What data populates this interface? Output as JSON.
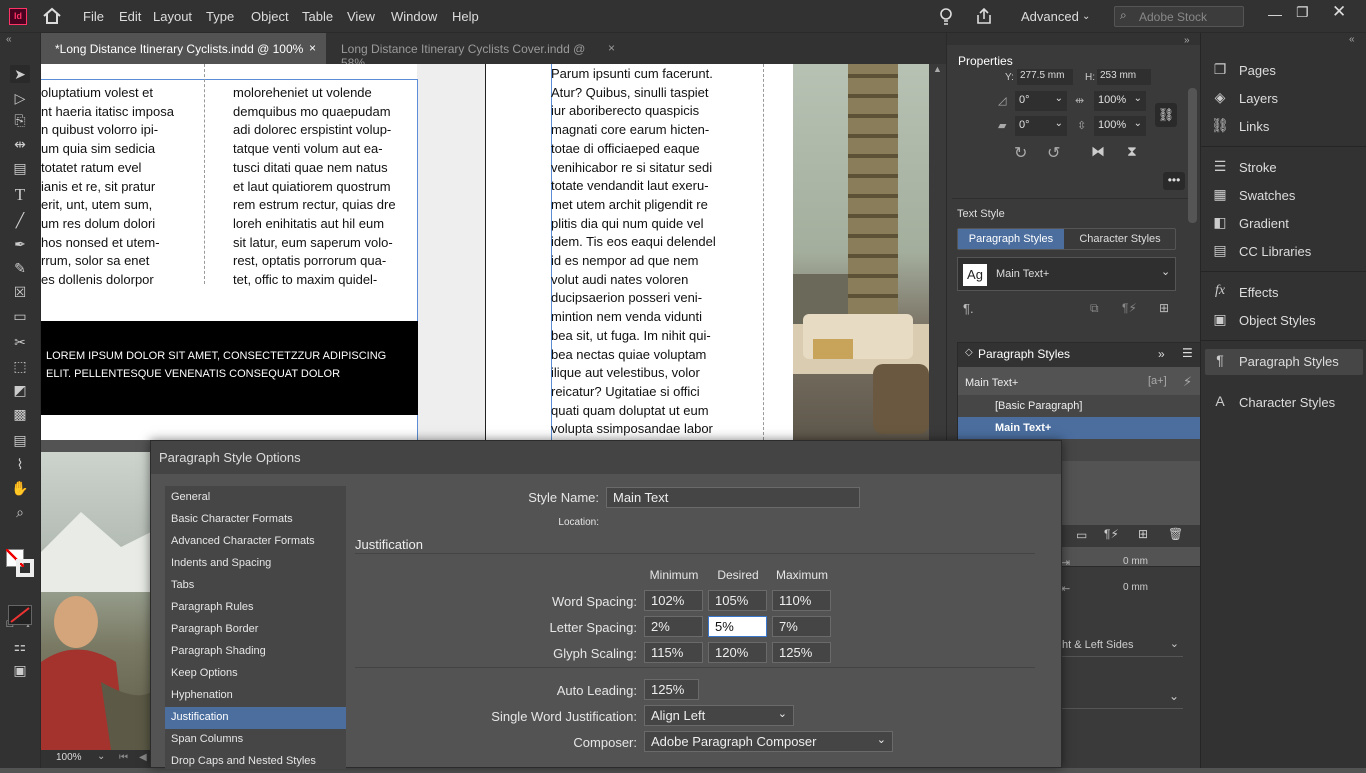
{
  "menubar": {
    "logo": "Id",
    "items": [
      "File",
      "Edit",
      "Layout",
      "Type",
      "Object",
      "Table",
      "View",
      "Window",
      "Help"
    ],
    "workspace": "Advanced",
    "search_placeholder": "Adobe Stock"
  },
  "tabs": [
    {
      "label": "*Long Distance Itinerary Cyclists.indd @ 100%",
      "close": "×"
    },
    {
      "label": "Long Distance Itinerary Cyclists Cover.indd @ 58%",
      "close": "×"
    }
  ],
  "document": {
    "col1": "oluptatium volest et\nnt haeria itatisc imposa\nn quibust volorro ipi-\num quia sim sedicia\ntotatet ratum evel\nianis et re, sit pratur\nerit, unt, utem sum,\num res dolum dolori\nhos nonsed et utem-\nrrum, solor sa enet\nes dollenis dolorpor",
    "col2": "moloreheniet ut volende\ndemquibus mo quaepudam\nadi dolorec erspistint volup-\ntatque venti volum aut ea-\ntusci ditati quae nem natus\net laut quiatiorem quostrum\nrem estrum rectur, quias dre\nloreh enihitatis aut hil eum\nsit latur, eum saperum volo-\nrest, optatis porrorum qua-\ntet, offic to maxim quidel-",
    "col3": "Parum ipsunti cum facerunt.\nAtur? Quibus, sinulli taspiet\niur aboriberecto quaspicis\nmagnati core earum hicten-\ntotae di officiaeped eaque\nvenihicabor re si sitatur sedi\ntotate vendandit laut exeru-\nmet utem archit pligendit re\nplitis dia qui num quide vel\nidem. Tis eos eaqui delendel\nid es nempor ad que nem\nvolut audi nates voloren\nducipsaerion posseri veni-\nmintion nem venda vidunti\nbea sit, ut fuga. Im nihit qui-\nbea nectas quiae voluptam\nilique aut velestibus, volor\nreicatur? Ugitatiae si offici\nquati quam doluptat ut eum\nvolupta ssimposandae labor",
    "banner": "LOREM IPSUM DOLOR SIT AMET, CONSECTETZZUR ADIPISCING\nELIT. PELLENTESQUE VENENATIS CONSEQUAT DOLOR"
  },
  "status": {
    "zoom": "100%"
  },
  "properties": {
    "title": "Properties",
    "y_label": "Y:",
    "y_value": "277.5 mm",
    "h_label": "H:",
    "h_value": "253 mm",
    "rotate": "0°",
    "shear": "0°",
    "scale_x": "100%",
    "scale_y": "100%",
    "text_style_title": "Text Style",
    "tab_paragraph": "Paragraph Styles",
    "tab_character": "Character Styles",
    "style_badge": "Ag",
    "current_style": "Main Text+",
    "para_panel_title": "Paragraph Styles",
    "para_panel_style": "Main Text+",
    "para_list": [
      "[Basic Paragraph]",
      "Main Text+"
    ],
    "indent_1": "0 mm",
    "indent_2": "0 mm",
    "align_partial": "ht & Left Sides"
  },
  "dock": {
    "items": [
      {
        "label": "Pages",
        "icon": "pages-icon"
      },
      {
        "label": "Layers",
        "icon": "layers-icon"
      },
      {
        "label": "Links",
        "icon": "links-icon"
      },
      {
        "label": "Stroke",
        "icon": "stroke-icon"
      },
      {
        "label": "Swatches",
        "icon": "swatches-icon"
      },
      {
        "label": "Gradient",
        "icon": "gradient-icon"
      },
      {
        "label": "CC Libraries",
        "icon": "cc-libraries-icon"
      },
      {
        "label": "Effects",
        "icon": "effects-icon"
      },
      {
        "label": "Object Styles",
        "icon": "object-styles-icon"
      },
      {
        "label": "Paragraph Styles",
        "icon": "paragraph-styles-icon"
      },
      {
        "label": "Character Styles",
        "icon": "character-styles-icon"
      }
    ]
  },
  "dialog": {
    "title": "Paragraph Style Options",
    "categories": [
      "General",
      "Basic Character Formats",
      "Advanced Character Formats",
      "Indents and Spacing",
      "Tabs",
      "Paragraph Rules",
      "Paragraph Border",
      "Paragraph Shading",
      "Keep Options",
      "Hyphenation",
      "Justification",
      "Span Columns",
      "Drop Caps and Nested Styles"
    ],
    "selected_category": "Justification",
    "style_name_label": "Style Name:",
    "style_name": "Main Text",
    "location_label": "Location:",
    "section": "Justification",
    "col_min": "Minimum",
    "col_des": "Desired",
    "col_max": "Maximum",
    "word_spacing_label": "Word Spacing:",
    "word_spacing": [
      "102%",
      "105%",
      "110%"
    ],
    "letter_spacing_label": "Letter Spacing:",
    "letter_spacing": [
      "2%",
      "5%",
      "7%"
    ],
    "glyph_scaling_label": "Glyph Scaling:",
    "glyph_scaling": [
      "115%",
      "120%",
      "125%"
    ],
    "auto_leading_label": "Auto Leading:",
    "auto_leading": "125%",
    "swj_label": "Single Word Justification:",
    "swj": "Align Left",
    "composer_label": "Composer:",
    "composer": "Adobe Paragraph Composer"
  }
}
